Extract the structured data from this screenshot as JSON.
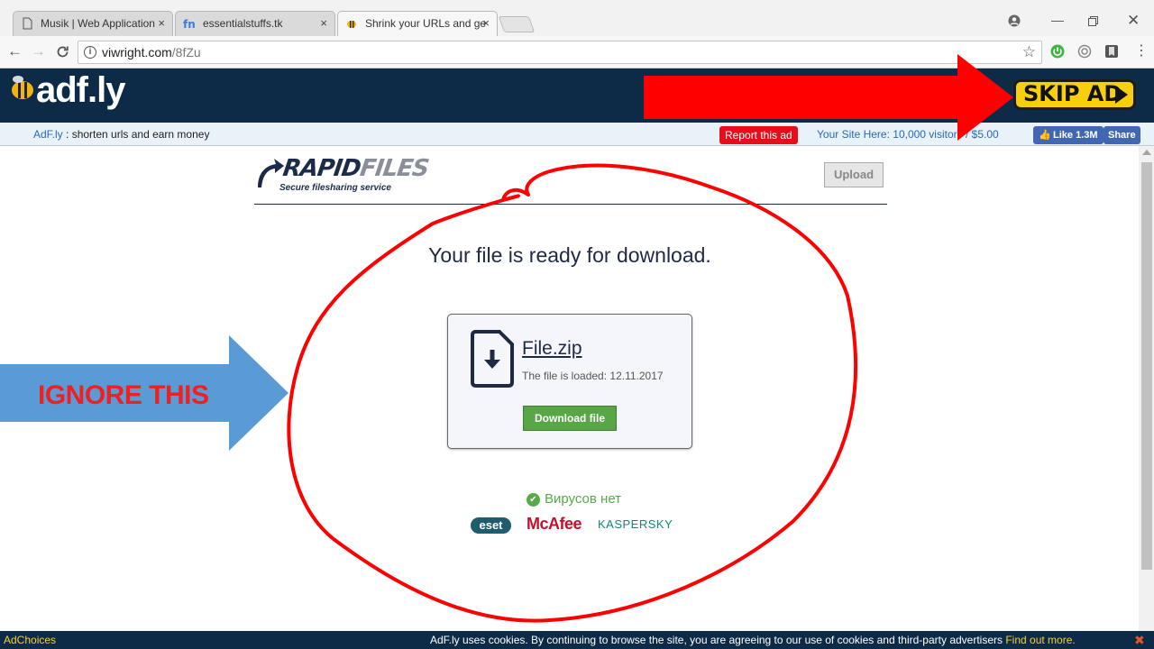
{
  "browser": {
    "tabs": [
      {
        "label": "Musik | Web Application",
        "icon": "page-icon"
      },
      {
        "label": "essentialstuffs.tk",
        "icon": "fn-icon"
      },
      {
        "label": "Shrink your URLs and ge",
        "icon": "bee-icon",
        "active": true
      }
    ],
    "tab_close": "×",
    "url_host": "viwright.com",
    "url_path": "/8fZu"
  },
  "adfly": {
    "logo": "adf.ly",
    "skip_label": "SKIP AD",
    "brand": "AdF.ly",
    "tagline": " : shorten urls and earn money",
    "report_label": "Report this ad",
    "your_site": "Your Site Here: 10,000 visitors / $5.00",
    "fb_like": "Like 1.3M",
    "fb_share": "Share"
  },
  "rapidfiles": {
    "logo_a": "RAPID",
    "logo_b": "FILES",
    "tagline": "Secure filesharing service",
    "upload_label": "Upload",
    "ready_text": "Your file is ready for download.",
    "file_name": "File.zip",
    "file_loaded": "The file is loaded: 12.11.2017",
    "download_label": "Download file",
    "no_virus": "Вирусов нет",
    "av_logos": [
      "eset",
      "McAfee",
      "KASPERSKY"
    ]
  },
  "annotation": {
    "ignore_text": "IGNORE THIS",
    "colors": {
      "red": "#ff0000",
      "blue": "#5b9bd5"
    }
  },
  "cookiebar": {
    "adchoices": "AdChoices",
    "text": "AdF.ly uses cookies. By continuing to browse the site, you are agreeing to our use of cookies and third-party advertisers ",
    "find_out": "Find out more.",
    "close": "✖"
  }
}
